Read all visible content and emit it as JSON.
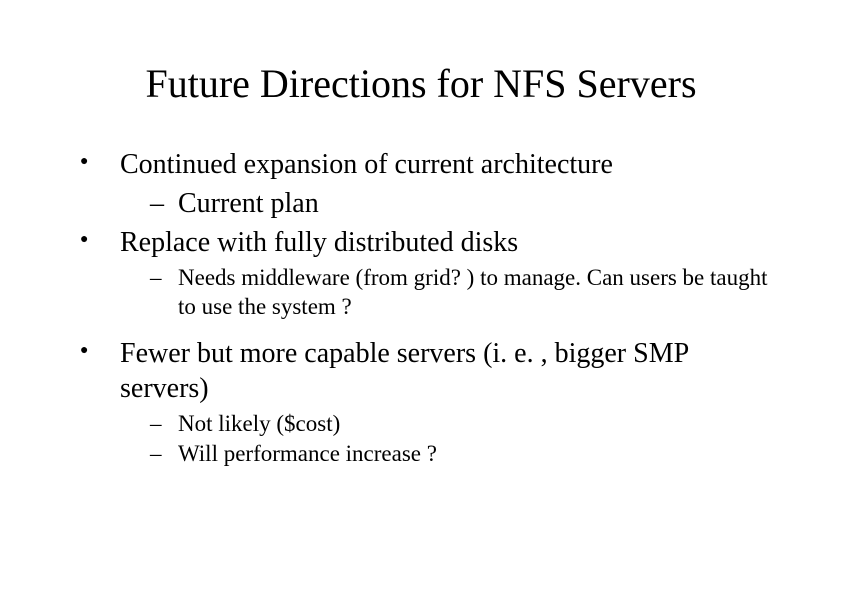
{
  "title": "Future Directions for NFS Servers",
  "bullets": {
    "b1": {
      "text": "Continued expansion of current architecture",
      "sub": {
        "s1": "Current plan"
      }
    },
    "b2": {
      "text": "Replace with fully distributed disks",
      "sub": {
        "s1": "Needs middleware (from grid? ) to manage. Can users be taught to use the system ?"
      }
    },
    "b3": {
      "text": "Fewer but more capable servers (i. e. , bigger SMP servers)",
      "sub": {
        "s1": "Not likely ($cost)",
        "s2": "Will performance increase ?"
      }
    }
  }
}
